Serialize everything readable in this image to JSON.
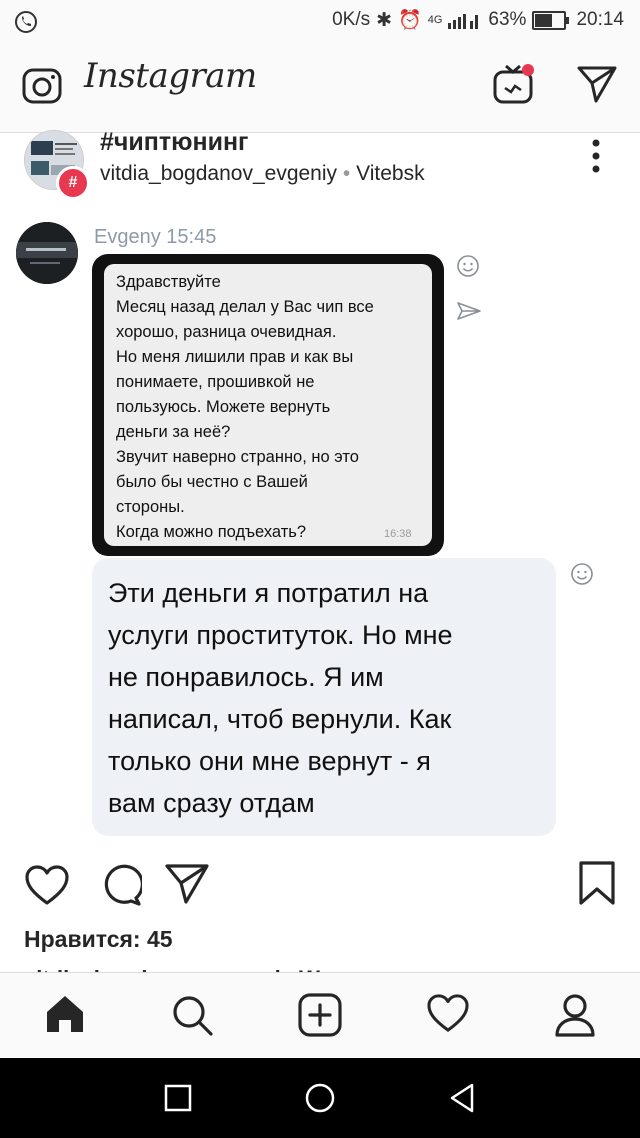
{
  "status_bar": {
    "speed": "0K/s",
    "network": "4G",
    "battery": "63%",
    "time": "20:14"
  },
  "header": {
    "app_name": "Instagram",
    "icons": [
      "camera-icon",
      "igtv-icon",
      "direct-icon"
    ]
  },
  "post": {
    "title": "#чиптюнинг",
    "username": "vitdia_bogdanov_evgeniy",
    "separator": "•",
    "location": "Vitebsk",
    "badge": "#"
  },
  "chat": {
    "sender": "Evgeny 15:45",
    "incoming_lines": [
      "Здравствуйте",
      "Месяц назад делал у Вас чип все",
      "хорошо, разница очевидная.",
      "Но меня лишили прав и как вы",
      "понимаете, прошивкой не",
      "пользуюсь. Можете вернуть",
      "деньги за неё?",
      "Звучит наверно странно, но это",
      "было бы честно с Вашей",
      "стороны.",
      "Когда можно подъехать?"
    ],
    "incoming_time": "16:38",
    "reply_lines": [
      "Эти деньги я потратил на",
      "услуги проституток. Но мне",
      "не понравилось. Я им",
      "написал, чтоб вернули. Как",
      "только они мне вернут - я",
      "вам сразу отдам"
    ]
  },
  "actions": {
    "likes": "Нравится: 45",
    "caption_partial": "vitdia_bogdanov_evgeniy Wo..."
  },
  "bottom_nav": [
    "home-icon",
    "search-icon",
    "add-post-icon",
    "activity-icon",
    "profile-icon"
  ],
  "android_nav": [
    "recents-icon",
    "home-circle-icon",
    "back-icon"
  ],
  "colors": {
    "accent_red": "#e8384f",
    "reply_bubble": "#eef1f6",
    "text": "#262626"
  }
}
